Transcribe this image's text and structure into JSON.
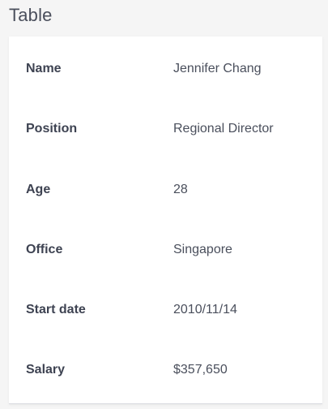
{
  "page_title": "Table",
  "table": {
    "rows": [
      {
        "label": "Name",
        "value": "Jennifer Chang"
      },
      {
        "label": "Position",
        "value": "Regional Director"
      },
      {
        "label": "Age",
        "value": "28"
      },
      {
        "label": "Office",
        "value": "Singapore"
      },
      {
        "label": "Start date",
        "value": "2010/11/14"
      },
      {
        "label": "Salary",
        "value": "$357,650"
      }
    ]
  }
}
